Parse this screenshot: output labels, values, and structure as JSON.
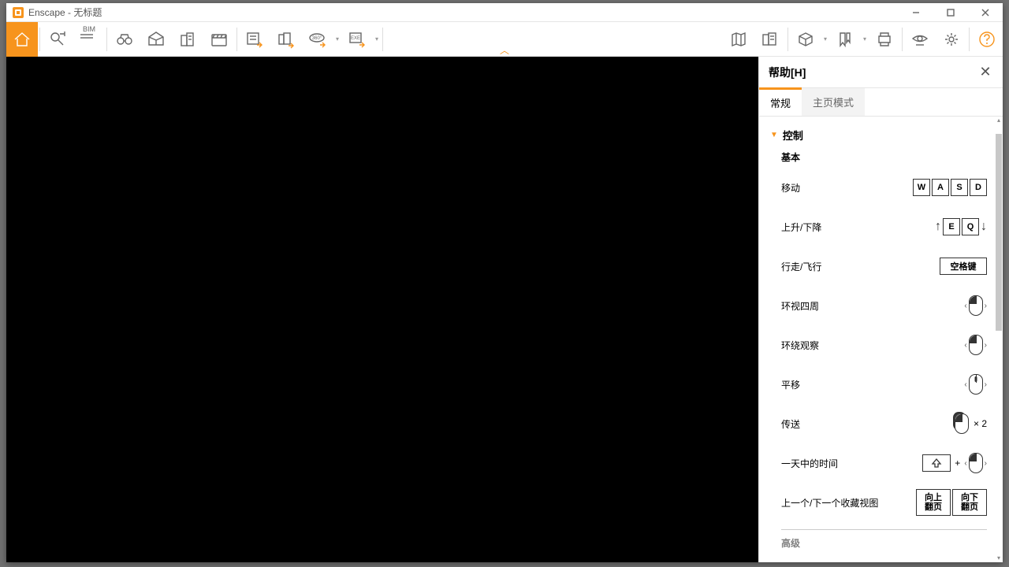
{
  "window": {
    "title": "Enscape - 无标题"
  },
  "toolbar": {
    "bim": "BIM"
  },
  "help": {
    "title": "帮助[H]",
    "tabs": {
      "general": "常规",
      "home": "主页模式"
    },
    "section_controls": "控制",
    "sub_basic": "基本",
    "rows": {
      "move": "移动",
      "updown": "上升/下降",
      "walkfly": "行走/飞行",
      "look": "环视四周",
      "orbit": "环绕观察",
      "pan": "平移",
      "teleport": "传送",
      "timeofday": "一天中的时间",
      "prevnext": "上一个/下一个收藏视图",
      "advanced": "高级"
    },
    "keys": {
      "W": "W",
      "A": "A",
      "S": "S",
      "D": "D",
      "E": "E",
      "Q": "Q",
      "space": "空格键",
      "x2": "× 2",
      "plus": "+",
      "pgup": "向上\n翻页",
      "pgdn": "向下\n翻页"
    }
  }
}
